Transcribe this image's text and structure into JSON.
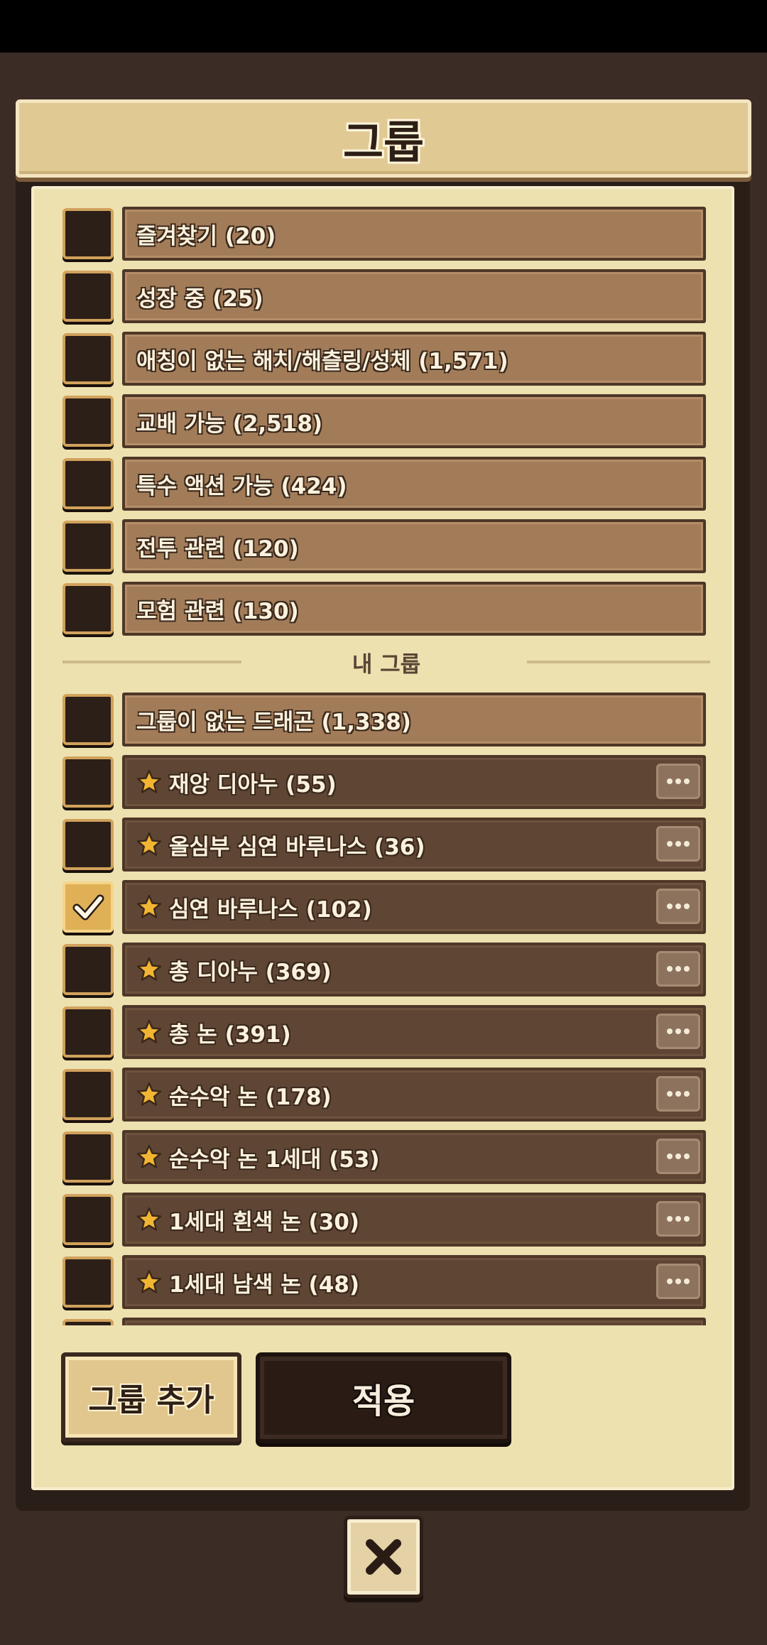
{
  "title": "그룹",
  "section_title": "내 그룹",
  "system_groups": [
    {
      "label": "즐겨찾기 (20)",
      "checked": false
    },
    {
      "label": "성장 중 (25)",
      "checked": false
    },
    {
      "label": "애칭이 없는 해치/해츨링/성체 (1,571)",
      "checked": false
    },
    {
      "label": "교배 가능 (2,518)",
      "checked": false
    },
    {
      "label": "특수 액션 가능 (424)",
      "checked": false
    },
    {
      "label": "전투 관련 (120)",
      "checked": false
    },
    {
      "label": "모험 관련 (130)",
      "checked": false
    }
  ],
  "ungrouped": {
    "label": "그룹이 없는 드래곤 (1,338)",
    "checked": false
  },
  "my_groups": [
    {
      "label": "재앙 디아누 (55)",
      "checked": false,
      "starred": true
    },
    {
      "label": "올심부 심연 바루나스 (36)",
      "checked": false,
      "starred": true
    },
    {
      "label": "심연 바루나스 (102)",
      "checked": true,
      "starred": true
    },
    {
      "label": "총 디아누 (369)",
      "checked": false,
      "starred": true
    },
    {
      "label": "총 논 (391)",
      "checked": false,
      "starred": true
    },
    {
      "label": "순수악 논 (178)",
      "checked": false,
      "starred": true
    },
    {
      "label": "순수악 논 1세대 (53)",
      "checked": false,
      "starred": true
    },
    {
      "label": "1세대 흰색 논 (30)",
      "checked": false,
      "starred": true
    },
    {
      "label": "1세대 남색 논 (48)",
      "checked": false,
      "starred": true
    }
  ],
  "buttons": {
    "add_group": "그룹 추가",
    "apply": "적용",
    "close_icon": "close-x-icon"
  },
  "colors": {
    "background": "#3b2c25",
    "panel": "#ede1b0",
    "system_bar": "#a27c59",
    "user_bar": "#5f4634",
    "star": "#f2b531"
  }
}
